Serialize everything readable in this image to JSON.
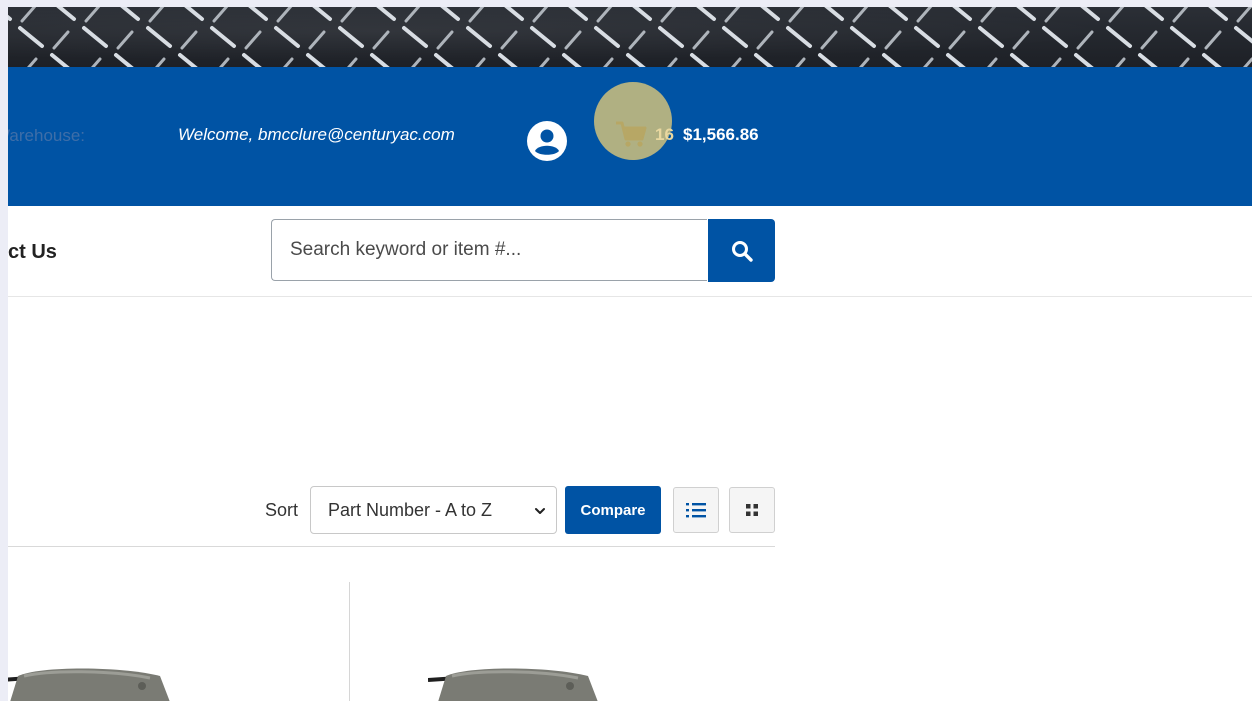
{
  "header": {
    "warehouse_label": "Warehouse:",
    "welcome_text": "Welcome, bmcclure@centuryac.com",
    "cart_count": "16",
    "cart_total": "$1,566.86",
    "colors": {
      "brand_blue": "#0053a4",
      "cart_highlight": "#e2ca78"
    },
    "icons": {
      "user": "user-circle-icon",
      "cart": "shopping-cart-icon"
    }
  },
  "nav": {
    "contact_label": "Contact Us",
    "contact_visible_text": "ct Us"
  },
  "search": {
    "placeholder": "Search keyword or item #...",
    "value": "",
    "button_icon": "search-icon"
  },
  "toolbar": {
    "sort_label": "Sort",
    "sort_selected": "Part Number - A to Z",
    "compare_label": "Compare",
    "list_view_icon": "list-view-icon",
    "grid_view_icon": "grid-view-icon"
  },
  "products": [
    {
      "image": "motor-image"
    },
    {
      "image": "motor-image"
    }
  ]
}
